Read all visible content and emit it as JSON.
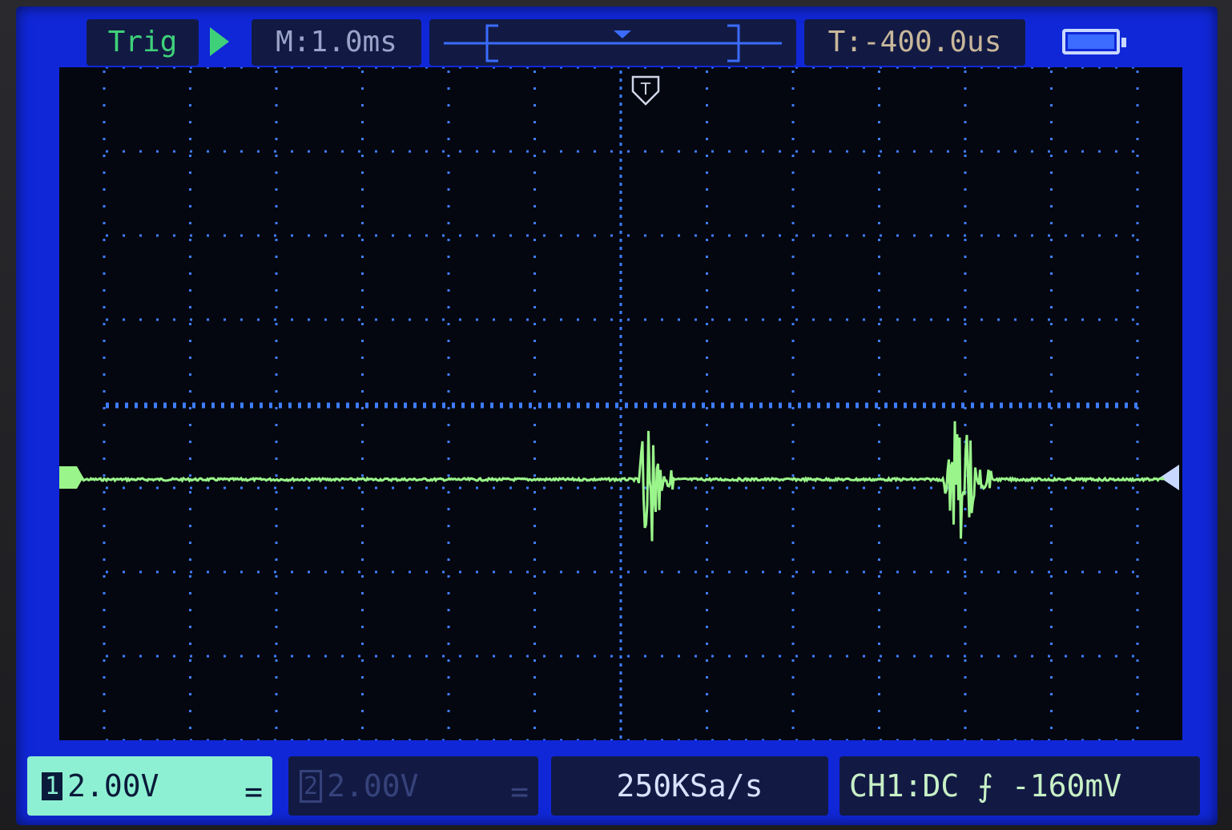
{
  "header": {
    "trig_status": "Trig",
    "timebase": "M:1.0ms",
    "trigger_offset": "T:-400.0us",
    "run_icon": "play-icon",
    "battery_icon": "battery-icon",
    "battery_level": 1.0
  },
  "footer": {
    "ch1": {
      "number": "1",
      "volts_per_div": "2.00V",
      "coupling": "="
    },
    "ch2": {
      "number": "2",
      "volts_per_div": "2.00V",
      "coupling": "="
    },
    "sample_rate": "250KSa/s",
    "trigger_info": "CH1:DC ⨍ -160mV"
  },
  "waveform": {
    "channel": "CH1",
    "trace_color": "#9af58a",
    "baseline_div": 0.9,
    "bursts_div": [
      {
        "start": 0.2,
        "end": 0.6,
        "peak_div": 0.8
      },
      {
        "start": 3.75,
        "end": 4.3,
        "peak_div": 0.8
      }
    ]
  },
  "markers": {
    "trigger_marker": "T",
    "ch1_ground_marker": "channel-1-marker",
    "trigger_level_marker": "trigger-level-marker"
  },
  "colors": {
    "frame": "#1027d8",
    "grid": "#3f7dff",
    "trace": "#9af58a"
  }
}
